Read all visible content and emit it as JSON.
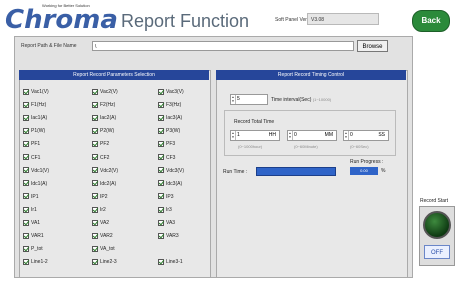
{
  "header": {
    "logo": "Chroma",
    "logo_tagline": "Working for Better Solution",
    "title": "Report  Function",
    "soft_panel_label": "Soft Panel Version",
    "soft_panel_version": "V3.08",
    "back_label": "Back"
  },
  "path": {
    "label": "Report Path & File Name",
    "value": "\\",
    "browse_label": "Browse"
  },
  "selection": {
    "title": "Report Record Parameters Selection",
    "col1": [
      "Vac1(V)",
      "F1(Hz)",
      "Iac1(A)",
      "P1(W)",
      "PF1",
      "CF1",
      "Vdc1(V)",
      "Idc1(A)",
      "IP1",
      "Ir1",
      "VA1",
      "VAR1",
      "P_tot",
      "Line1-2"
    ],
    "col2": [
      "Vac2(V)",
      "F2(Hz)",
      "Iac2(A)",
      "P2(W)",
      "PF2",
      "CF2",
      "Vdc2(V)",
      "Idc2(A)",
      "IP2",
      "Ir2",
      "VA2",
      "VAR2",
      "VA_tot",
      "Line2-3"
    ],
    "col3": [
      "Vac3(V)",
      "F3(Hz)",
      "Iac3(A)",
      "P3(W)",
      "PF3",
      "CF3",
      "Vdc3(V)",
      "Idc3(A)",
      "IP3",
      "Ir3",
      "VA3",
      "VAR3",
      "",
      "Line3-1"
    ]
  },
  "timing": {
    "title": "Report Record Timing Control",
    "interval_value": "5",
    "interval_label": "Time interval(Sec)",
    "interval_range": "(1~10000)",
    "total_label": "Record Total Time",
    "hh_value": "1",
    "hh_unit": "HH",
    "hh_range": "(0~1000hour)",
    "mm_value": "0",
    "mm_unit": "MM",
    "mm_range": "(0~60Minute)",
    "ss_value": "0",
    "ss_unit": "SS",
    "ss_range": "(0~60Sec)",
    "run_time_label": "Run Time :",
    "run_progress_label": "Run Progress :",
    "run_progress_value": "0.00",
    "run_progress_unit": "%"
  },
  "record": {
    "label": "Record Start",
    "off_label": "OFF"
  },
  "colors": {
    "header_bar": "#26469a",
    "accent_blue": "#2f64c8",
    "back_green": "#2b8a3a"
  }
}
